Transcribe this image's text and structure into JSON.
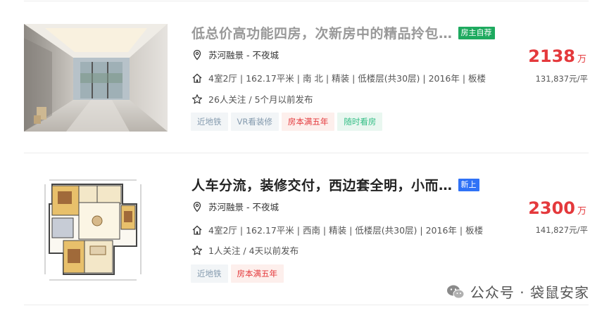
{
  "listings": [
    {
      "title": "低总价高功能四房，次新房中的精品拎包…",
      "tag": "房主自荐",
      "tag_color": "#1eaa5f",
      "location": "苏河融景 - 不夜城",
      "details": "4室2厅 | 162.17平米 | 南 北 | 精装 | 低楼层(共30层) | 2016年 | 板楼",
      "follow": "26人关注 / 5个月以前发布",
      "labels": [
        {
          "text": "近地铁",
          "style": "gray"
        },
        {
          "text": "VR看装修",
          "style": "gray"
        },
        {
          "text": "房本满五年",
          "style": "red"
        },
        {
          "text": "随时看房",
          "style": "green"
        }
      ],
      "total_price": "2138",
      "price_unit": "万",
      "unit_price": "131,837元/平"
    },
    {
      "title": "人车分流，装修交付，西边套全明，小而…",
      "tag": "新上",
      "tag_color": "#3072f6",
      "location": "苏河融景 - 不夜城",
      "details": "4室2厅 | 162.17平米 | 西南 | 精装 | 低楼层(共30层) | 2016年 | 板楼",
      "follow": "1人关注 / 4天以前发布",
      "labels": [
        {
          "text": "近地铁",
          "style": "gray"
        },
        {
          "text": "房本满五年",
          "style": "red"
        }
      ],
      "total_price": "2300",
      "price_unit": "万",
      "unit_price": "141,827元/平"
    }
  ],
  "watermark": {
    "text": "公众号 · 袋鼠安家",
    "icon": "wechat-icon"
  },
  "colors": {
    "price_red": "#e4393c",
    "accent_green": "#1eaa5f",
    "accent_blue": "#3072f6"
  }
}
